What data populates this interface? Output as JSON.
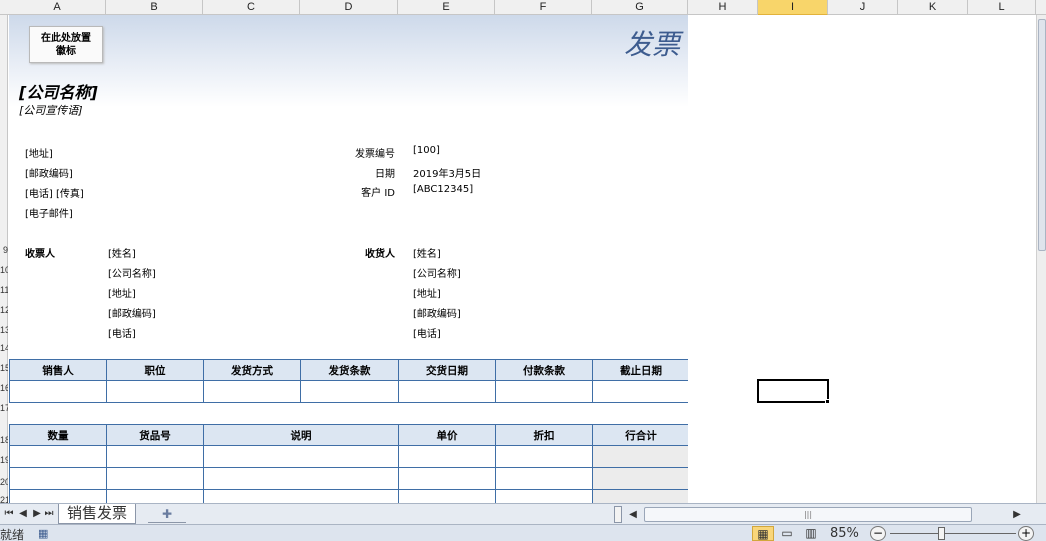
{
  "columns": [
    "A",
    "B",
    "C",
    "D",
    "E",
    "F",
    "G",
    "H",
    "I",
    "J",
    "K",
    "L"
  ],
  "active_column": "I",
  "rows": [
    "9",
    "10",
    "11",
    "12",
    "13",
    "14",
    "15",
    "16",
    "17",
    "18",
    "19",
    "20",
    "21"
  ],
  "invoice": {
    "logo_placeholder": "在此处放置\n徽标",
    "title": "发票",
    "company_name": "[公司名称]",
    "slogan": "[公司宣传语]",
    "sender": {
      "address": "[地址]",
      "postal_code": "[邮政编码]",
      "phone_fax": "[电话] [传真]",
      "email": "[电子邮件]"
    },
    "meta": {
      "invoice_no_label": "发票编号",
      "invoice_no": "[100]",
      "date_label": "日期",
      "date": "2019年3月5日",
      "customer_id_label": "客户 ID",
      "customer_id": "[ABC12345]"
    },
    "bill_to": {
      "label": "收票人",
      "lines": [
        "[姓名]",
        "[公司名称]",
        "[地址]",
        "[邮政编码]",
        "[电话]"
      ]
    },
    "ship_to": {
      "label": "收货人",
      "lines": [
        "[姓名]",
        "[公司名称]",
        "[地址]",
        "[邮政编码]",
        "[电话]"
      ]
    },
    "terms_table": {
      "headers": [
        "销售人",
        "职位",
        "发货方式",
        "发货条款",
        "交货日期",
        "付款条款",
        "截止日期"
      ]
    },
    "items_table": {
      "headers": [
        "数量",
        "货品号",
        "说明",
        "单价",
        "折扣",
        "行合计"
      ]
    }
  },
  "sheet_tab": "销售发票",
  "status": {
    "text": "就绪",
    "zoom": "85%"
  }
}
